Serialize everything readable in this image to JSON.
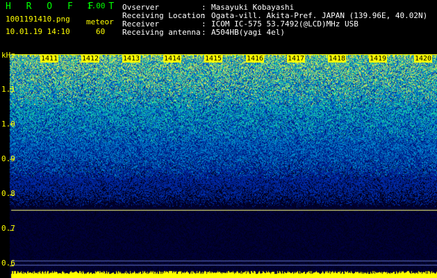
{
  "app": {
    "name": "H R O F F T",
    "version": "1.00"
  },
  "file": {
    "name": "1001191410.png",
    "datetime": "10.01.19 14:10"
  },
  "mode": {
    "label": "meteor",
    "value": "60"
  },
  "info": [
    {
      "label": "Ovserver",
      "value": "Masayuki Kobayashi"
    },
    {
      "label": "Receiving Location",
      "value": "Ogata-vill. Akita-Pref. JAPAN (139.96E, 40.02N)"
    },
    {
      "label": "Receiver",
      "value": "ICOM IC-575 53.7492(@LCD)MHz USB"
    },
    {
      "label": "Receiving antenna",
      "value": "A504HB(yagi 4el)"
    }
  ],
  "spectrogram": {
    "y_unit": "kHz",
    "y_ticks": [
      "1.1",
      "1.0",
      "0.9",
      "0.8",
      "0.7",
      "0.6"
    ],
    "y_tick_values": [
      1.1,
      1.0,
      0.9,
      0.8,
      0.7,
      0.6
    ],
    "x_ticks": [
      "1411",
      "1412",
      "1413",
      "1414",
      "1415",
      "1416",
      "1417",
      "1418",
      "1419",
      "1420"
    ],
    "y_range": [
      0.585,
      1.195
    ],
    "marker_line_khz": 0.758,
    "colors": {
      "axis": "#ffff00",
      "marker": "#ffff80",
      "text": "#ffffff"
    }
  }
}
